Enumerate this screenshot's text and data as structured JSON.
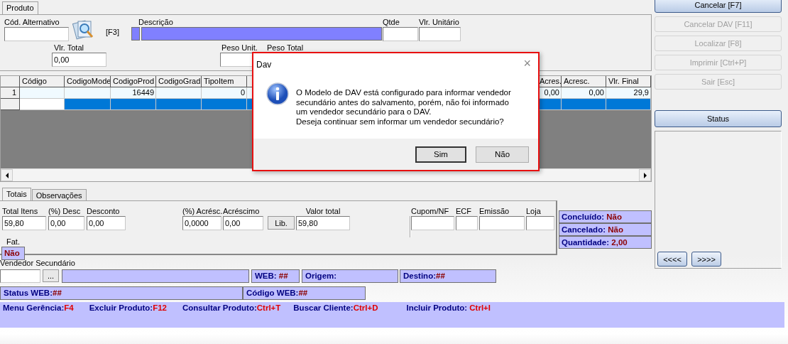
{
  "top_tabs": [
    {
      "label": "Produto",
      "selected": true
    }
  ],
  "product_form": {
    "cod_alternativo": {
      "label": "Cód. Alternativo"
    },
    "shortcut": "[F3]",
    "descricao": {
      "label": "Descrição"
    },
    "qtde": {
      "label": "Qtde"
    },
    "vlr_unitario": {
      "label": "Vlr. Unitário"
    },
    "vlr_total": {
      "label": "Vlr. Total",
      "value": "0,00"
    },
    "peso_unit": {
      "label": "Peso Unit."
    },
    "peso_total": {
      "label": "Peso Total"
    }
  },
  "grid": {
    "columns": [
      {
        "label": "Código"
      },
      {
        "label": "CodigoMode"
      },
      {
        "label": "CodigoProd"
      },
      {
        "label": "CodigoGrad"
      },
      {
        "label": "TipoItem"
      },
      {
        "label": "Acres."
      },
      {
        "label": "Acresc."
      },
      {
        "label": "Vlr. Final"
      }
    ],
    "rows": [
      {
        "header": "1",
        "selected": false,
        "cells": [
          {},
          {},
          {
            "value": "16449"
          },
          {},
          {
            "value": "0"
          },
          {
            "value": "0,00"
          },
          {
            "value": "0,00"
          },
          {
            "value": "29,9"
          }
        ]
      },
      {
        "selected": true,
        "cells": [
          {
            "focused": true
          },
          {},
          {},
          {},
          {},
          {},
          {},
          {}
        ]
      }
    ]
  },
  "bottom_tabs": [
    {
      "label": "Totais",
      "selected": true
    },
    {
      "label": "Observações",
      "selected": false
    }
  ],
  "totals": {
    "discount_fields": [
      {
        "label": "Total Itens",
        "value": "59,80"
      },
      {
        "label": "(%) Desc",
        "value": "0,00"
      },
      {
        "label": "Desconto",
        "value": "0,00"
      }
    ],
    "surcharge_fields": [
      {
        "label": "(%) Acrésc.",
        "value": "0,0000"
      },
      {
        "label": "Acréscimo",
        "value": "0,00"
      }
    ],
    "lib_button": "Lib.",
    "valor_total": {
      "label": "Valor total",
      "value": "59,80"
    },
    "document_fields": [
      {
        "label": "Cupom/NF"
      },
      {
        "label": "ECF"
      },
      {
        "label": "Emissão"
      },
      {
        "label": "Loja"
      }
    ],
    "fat": {
      "label": "Fat.",
      "value": "Não"
    }
  },
  "status_boxes": [
    {
      "label": "Concluído:",
      "value": "Não"
    },
    {
      "label": "Cancelado:",
      "value": "Não"
    },
    {
      "label": "Quantidade:",
      "value": "2,00"
    }
  ],
  "vendedor": {
    "label": "Vendedor Secundário",
    "browse_button": "..."
  },
  "web_boxes": [
    {
      "label": "WEB:",
      "value": "##"
    },
    {
      "label": "Origem:"
    },
    {
      "label": "Destino:",
      "value": "##"
    }
  ],
  "status_row": [
    {
      "label": "Status WEB:",
      "value": "##"
    },
    {
      "label": "Código WEB:",
      "value": "##"
    }
  ],
  "shortcuts": [
    {
      "label": "Menu Gerência:",
      "key": "F4"
    },
    {
      "label": "Excluir Produto:",
      "key": "F12"
    },
    {
      "label": "Consultar Produto:",
      "key": "Ctrl+T"
    },
    {
      "label": "Buscar Cliente:",
      "key": "Ctrl+D"
    },
    {
      "label": "Incluir Produto:",
      "key": "Ctrl+I"
    }
  ],
  "side_buttons": [
    {
      "label": "Cancelar [F7]",
      "disabled": false
    },
    {
      "label": "Cancelar DAV [F11]",
      "disabled": true
    },
    {
      "label": "Localizar [F8]",
      "disabled": true
    },
    {
      "label": "Imprimir [Ctrl+P]",
      "disabled": true
    },
    {
      "label": "Sair [Esc]",
      "disabled": true
    }
  ],
  "status_button": "Status",
  "nav_buttons": [
    {
      "label": "<<<<"
    },
    {
      "label": ">>>>"
    }
  ],
  "dialog": {
    "title": "Dav",
    "close": "×",
    "message": "O Modelo de DAV está configurado para informar vendedor\nsecundário antes do salvamento, porém, não foi informado\num vendedor secundário para o DAV.\nDeseja continuar sem informar um vendedor secundário?",
    "buttons": [
      {
        "label": "Sim",
        "default": true
      },
      {
        "label": "Não",
        "default": false
      }
    ]
  }
}
